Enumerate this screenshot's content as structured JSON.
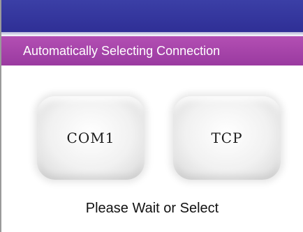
{
  "header": {
    "status_text": "Automatically Selecting Connection"
  },
  "connections": {
    "com1_label": "COM1",
    "tcp_label": "TCP"
  },
  "footer": {
    "message": "Please Wait or Select"
  },
  "colors": {
    "titlebar": "#2f2f96",
    "status_band": "#a845a8",
    "text_dark": "#111111"
  }
}
